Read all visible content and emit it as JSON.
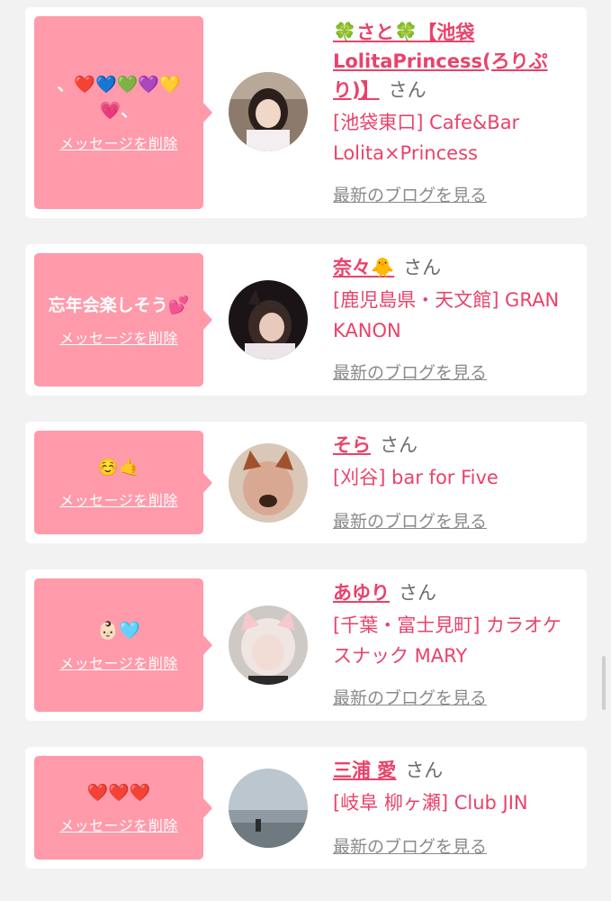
{
  "cards": [
    {
      "message": "、❤️💙💚💜💛💗、",
      "delete_label": "メッセージを削除",
      "name": "🍀さと🍀【池袋LolitaPrincess(ろりぷり)】",
      "honorific": "さん",
      "shop": "[池袋東口] Cafe&Bar Lolita×Princess",
      "blog_label": "最新のブログを見る"
    },
    {
      "message": "忘年会楽しそう💕",
      "delete_label": "メッセージを削除",
      "name": "奈々🐥",
      "honorific": "さん",
      "shop": "[鹿児島県・天文館] GRAN KANON",
      "blog_label": "最新のブログを見る"
    },
    {
      "message": "☺️🤙",
      "delete_label": "メッセージを削除",
      "name": "そら",
      "honorific": "さん",
      "shop": "[刈谷] bar for Five",
      "blog_label": "最新のブログを見る"
    },
    {
      "message": "👶🏻🩵",
      "delete_label": "メッセージを削除",
      "name": "あゆり",
      "honorific": "さん",
      "shop": "[千葉・富士見町] カラオケスナック MARY",
      "blog_label": "最新のブログを見る"
    },
    {
      "message": "❤️❤️❤️",
      "delete_label": "メッセージを削除",
      "name": "三浦 愛",
      "honorific": "さん",
      "shop": "[岐阜 柳ヶ瀬] Club JIN",
      "blog_label": "最新のブログを見る"
    }
  ],
  "colors": {
    "bubble": "#ff9aab",
    "accent": "#e9426a",
    "muted": "#8a8a8a",
    "background": "#f2f2f2"
  }
}
